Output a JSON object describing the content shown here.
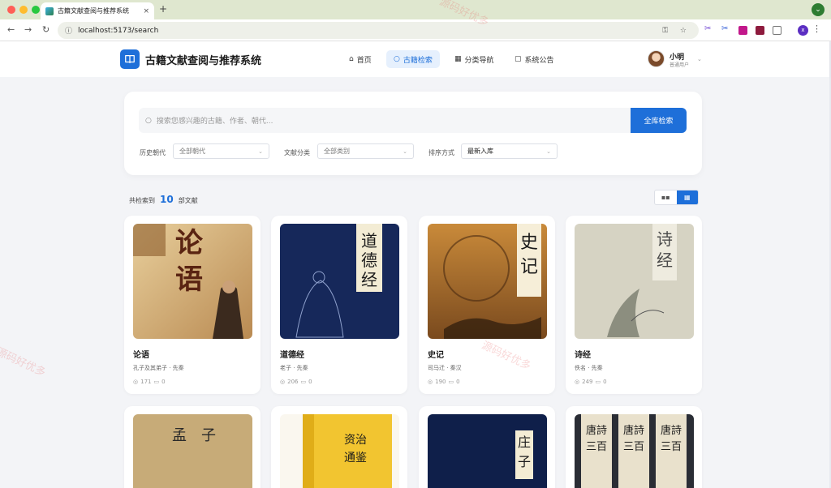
{
  "browser": {
    "tab_title": "古籍文献查阅与推荐系统",
    "tab_close": "×",
    "new_tab": "+",
    "url": "localhost:5173/search",
    "profile_initial": "x"
  },
  "header": {
    "site_title": "古籍文献查阅与推荐系统",
    "nav": [
      {
        "label": "首页",
        "icon": "home-icon"
      },
      {
        "label": "古籍检索",
        "icon": "search-icon"
      },
      {
        "label": "分类导航",
        "icon": "grid-icon"
      },
      {
        "label": "系统公告",
        "icon": "notice-icon"
      }
    ],
    "user": {
      "name": "小明",
      "role": "普通用户"
    }
  },
  "search": {
    "placeholder": "搜索您感兴趣的古籍、作者、朝代...",
    "button": "全库检索",
    "filters": [
      {
        "label": "历史朝代",
        "value": "全部朝代"
      },
      {
        "label": "文献分类",
        "value": "全部类别"
      },
      {
        "label": "排序方式",
        "value": "最新入库"
      }
    ]
  },
  "results": {
    "prefix": "共检索到",
    "count": "10",
    "suffix": "部文献"
  },
  "books": [
    {
      "title": "论语",
      "meta": "孔子及其弟子 · 先秦",
      "views": "171",
      "comments": "0"
    },
    {
      "title": "道德经",
      "meta": "老子 · 先秦",
      "views": "206",
      "comments": "0"
    },
    {
      "title": "史记",
      "meta": "司马迁 · 秦汉",
      "views": "190",
      "comments": "0"
    },
    {
      "title": "诗经",
      "meta": "佚名 · 先秦",
      "views": "249",
      "comments": "0"
    }
  ],
  "covers": [
    {
      "text": "论语"
    },
    {
      "text": "道德经"
    },
    {
      "text": "史记"
    },
    {
      "text": "诗经"
    },
    {
      "text": "孟子"
    },
    {
      "text": "资治通鉴"
    },
    {
      "text": "庄子"
    },
    {
      "text": "唐詩三百首"
    }
  ],
  "watermark": "源码好优多",
  "colors": {
    "accent": "#1e6fd9"
  }
}
